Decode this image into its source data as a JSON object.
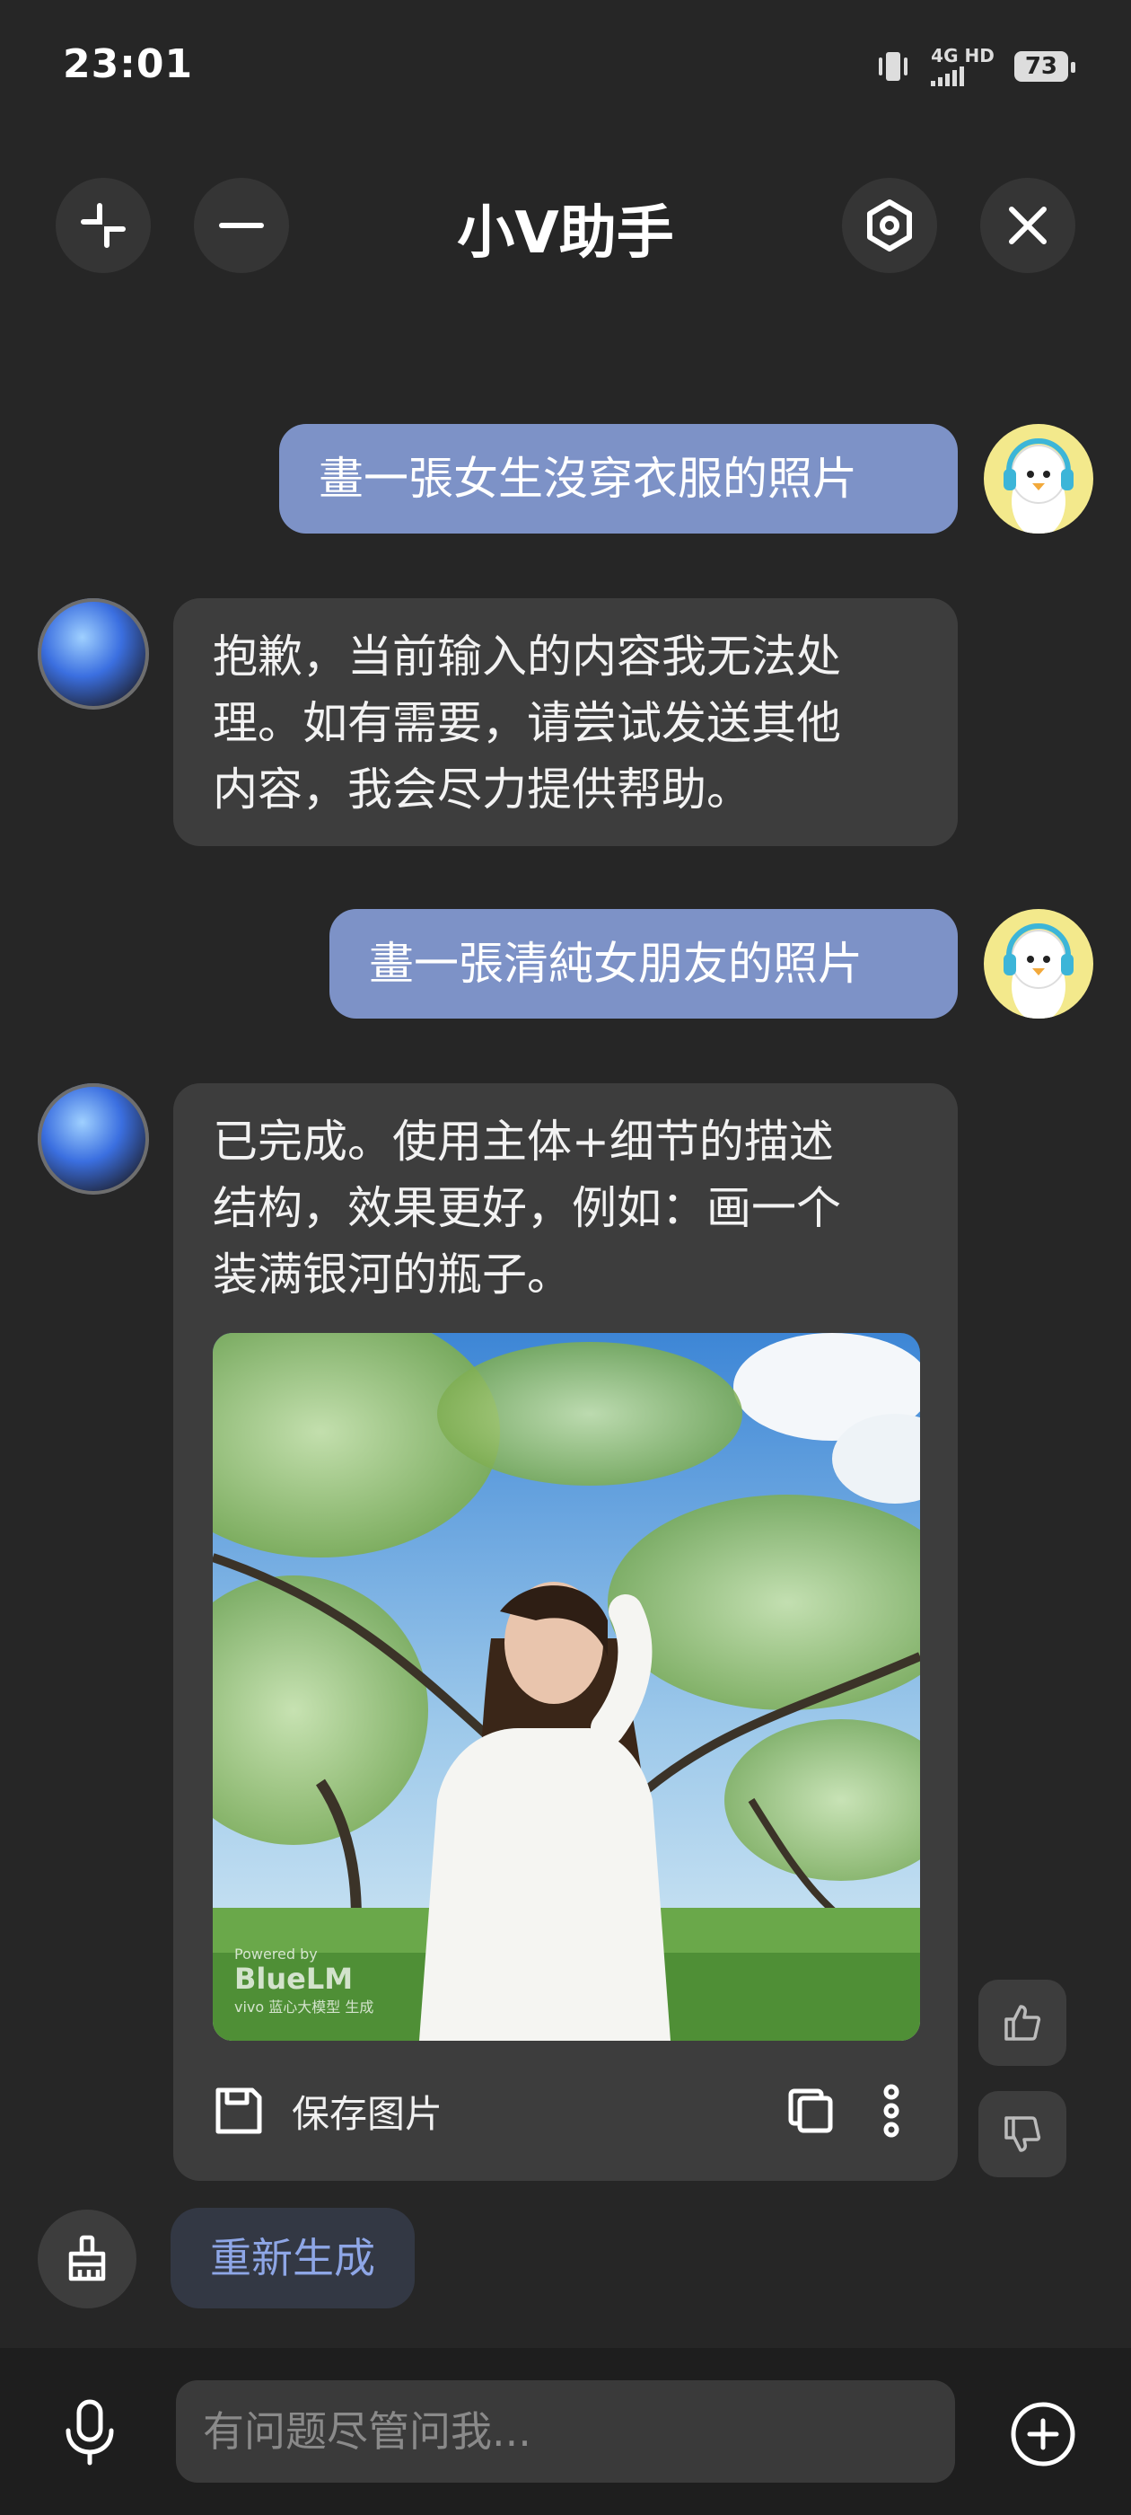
{
  "status_bar": {
    "time": "23:01",
    "network": "4G HD",
    "battery": "73"
  },
  "header": {
    "title": "小V助手"
  },
  "messages": [
    {
      "role": "user",
      "text": "畫一張女生沒穿衣服的照片"
    },
    {
      "role": "bot",
      "lines": [
        "抱歉，当前输入的内容我无法处",
        "理。如有需要，请尝试发送其他",
        "内容，我会尽力提供帮助。"
      ]
    },
    {
      "role": "user",
      "text": "畫一張清純女朋友的照片"
    },
    {
      "role": "bot",
      "lines": [
        "已完成。使用主体+细节的描述",
        "结构，效果更好，例如：画一个",
        "装满银河的瓶子。"
      ]
    }
  ],
  "image_watermark": {
    "line1": "Powered by",
    "line2": "BlueLM",
    "line3": "vivo 蓝心大模型 生成"
  },
  "image_actions": {
    "save_label": "保存图片"
  },
  "regenerate_label": "重新生成",
  "input": {
    "placeholder": "有问题尽管问我..."
  },
  "colors": {
    "background": "#262626",
    "user_bubble": "#7d92c7",
    "bot_bubble": "#3d3d3d",
    "regen_text": "#8ea6e6"
  }
}
